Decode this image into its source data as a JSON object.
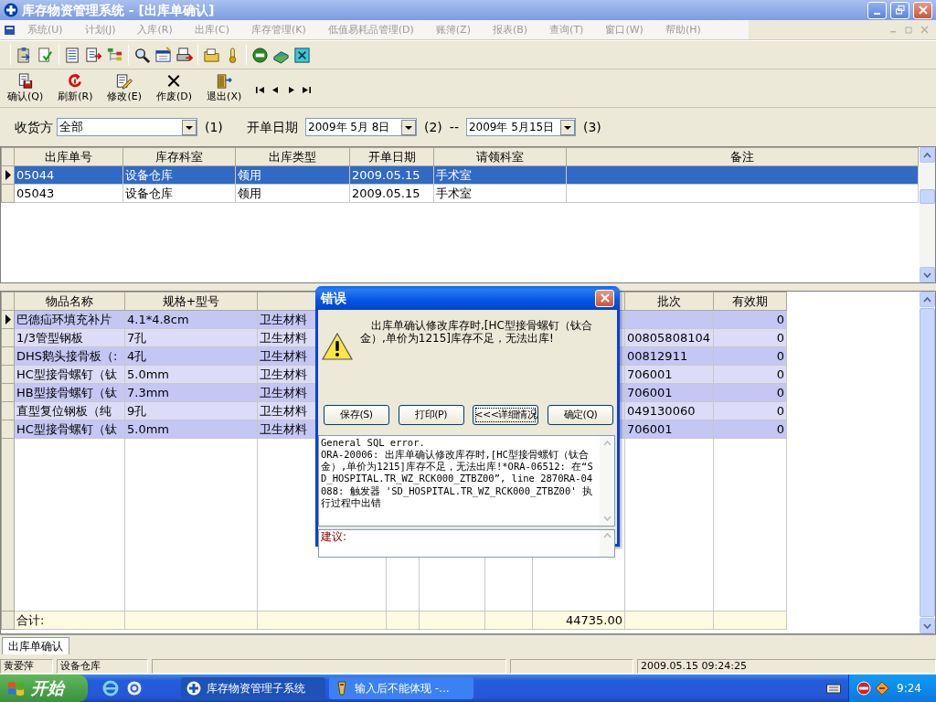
{
  "window": {
    "title": "库存物资管理系统 - [出库单确认]"
  },
  "menu": [
    {
      "label": "系统(U)",
      "disabled": true
    },
    {
      "label": "计划(J)",
      "disabled": true
    },
    {
      "label": "入库(R)",
      "disabled": true
    },
    {
      "label": "出库(C)",
      "disabled": true
    },
    {
      "label": "库存管理(K)",
      "disabled": true
    },
    {
      "label": "低值易耗品管理(D)",
      "disabled": true
    },
    {
      "label": "账簿(Z)",
      "disabled": true
    },
    {
      "label": "报表(B)",
      "disabled": true
    },
    {
      "label": "查询(T)",
      "disabled": true
    },
    {
      "label": "窗口(W)",
      "disabled": true
    },
    {
      "label": "帮助(H)",
      "disabled": true
    }
  ],
  "actions": [
    {
      "label": "确认(Q)"
    },
    {
      "label": "刷新(R)"
    },
    {
      "label": "修改(E)"
    },
    {
      "label": "作废(D)"
    },
    {
      "label": "退出(X)"
    }
  ],
  "filters": {
    "receiver_label": "收货方",
    "receiver_value": "全部",
    "receiver_hint": "(1)",
    "date_label": "开单日期",
    "date_from": "2009年 5月 8日",
    "date_from_hint": "(2)",
    "date_separator": "--",
    "date_to": "2009年 5月15日",
    "date_to_hint": "(3)"
  },
  "orders": {
    "columns": [
      "出库单号",
      "库存科室",
      "出库类型",
      "开单日期",
      "请领科室",
      "备注"
    ],
    "rows": [
      {
        "cells": [
          "05044",
          "设备仓库",
          "领用",
          "2009.05.15",
          "手术室"
        ],
        "selected": true
      },
      {
        "cells": [
          "05043",
          "设备仓库",
          "领用",
          "2009.05.15",
          "手术室"
        ],
        "selected": false
      }
    ]
  },
  "items": {
    "columns": {
      "name": "物品名称",
      "spec": "规格+型号",
      "batch": "批次",
      "expiry": "有效期"
    },
    "rows": [
      {
        "name": "巴德疝环填充补片",
        "spec": "4.1*4.8cm",
        "column_3": "卫生材料",
        "expiry": "0",
        "selected": true
      },
      {
        "name": "1/3管型钢板",
        "spec": "7孔",
        "column_3": "卫生材料",
        "batch": "00805808104",
        "expiry": "0",
        "selected": false
      },
      {
        "name": "DHS鹅头接骨板（:",
        "spec": "4孔",
        "column_3": "卫生材料",
        "batch": "00812911",
        "expiry": "0",
        "selected": false
      },
      {
        "name": "HC型接骨螺钉（钛",
        "spec": "5.0mm",
        "column_3": "卫生材料",
        "batch": "706001",
        "expiry": "0",
        "selected": false
      },
      {
        "name": "HB型接骨螺钉（钛",
        "spec": "7.3mm",
        "column_3": "卫生材料",
        "batch": "706001",
        "expiry": "0",
        "selected": false
      },
      {
        "name": "直型复位钢板（纯",
        "spec": "9孔",
        "column_3": "卫生材料",
        "batch": "049130060",
        "expiry": "0",
        "selected": false
      },
      {
        "name": "HC型接骨螺钉（钛",
        "spec": "5.0mm",
        "column_3": "卫生材料",
        "batch": "706001",
        "expiry": "0",
        "selected": false
      }
    ],
    "total": {
      "label": "合计:",
      "amount": "44735.00"
    }
  },
  "dialog": {
    "title": "错误",
    "message": "出库单确认修改库存时,[HC型接骨螺钉（钛合金）,单价为1215]库存不足，无法出库!",
    "buttons": [
      {
        "label": "保存(S)",
        "focused": false
      },
      {
        "label": "打印(P)",
        "focused": false
      },
      {
        "label": "<<<详细情况",
        "focused": true
      },
      {
        "label": "确定(Q)",
        "focused": false
      }
    ],
    "details": "General SQL error.\nORA-20006: 出库单确认修改库存时,[HC型接骨螺钉（钛合金）,单价为1215]库存不足，无法出库!*ORA-06512: 在“SD_HOSPITAL.TR_WZ_RCK000_ZTBZ00”, line 2870RA-04088: 触发器 'SD_HOSPITAL.TR_WZ_RCK000_ZTBZ00' 执行过程中出错",
    "suggestion_label": "建议:"
  },
  "tabs": [
    {
      "label": "出库单确认",
      "selected": true
    }
  ],
  "status_bar": {
    "user": "黄爱萍",
    "department": "设备仓库",
    "time": "2009.05.15 09:24:25"
  },
  "taskbar": {
    "start": "开始",
    "tasks": [
      {
        "label": "库存物资管理子系统",
        "selected": true
      },
      {
        "label": "输入后不能体现 -...",
        "selected": false
      }
    ],
    "clock": "9:24"
  }
}
